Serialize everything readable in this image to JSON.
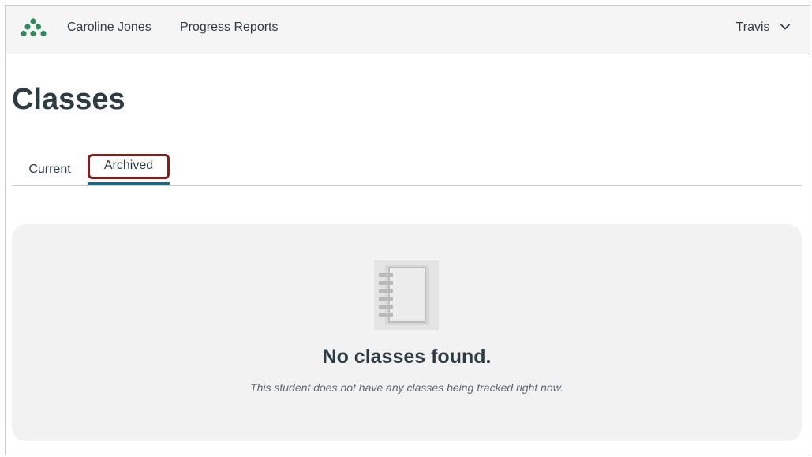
{
  "nav": {
    "student_name": "Caroline Jones",
    "progress_reports": "Progress Reports",
    "user_name": "Travis",
    "brand_color": "#2e8b57"
  },
  "page": {
    "title": "Classes"
  },
  "tabs": [
    {
      "label": "Current",
      "active": false
    },
    {
      "label": "Archived",
      "active": true
    }
  ],
  "empty_state": {
    "icon": "notebook-icon",
    "title": "No classes found.",
    "message": "This student does not have any classes being tracked right now."
  }
}
